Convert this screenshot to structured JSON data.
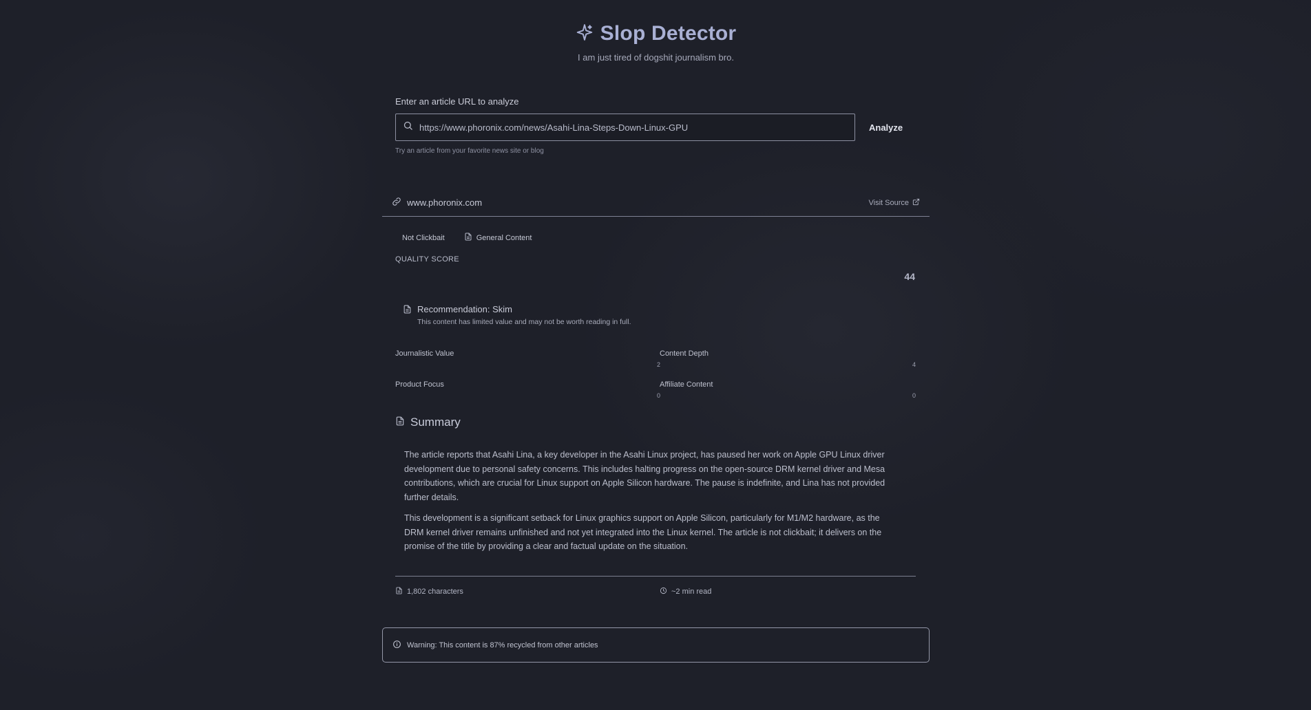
{
  "app": {
    "title": "Slop Detector",
    "subtitle": "I am just tired of dogshit journalism bro."
  },
  "url_form": {
    "label": "Enter an article URL to analyze",
    "value": "https://www.phoronix.com/news/Asahi-Lina-Steps-Down-Linux-GPU",
    "analyze_label": "Analyze",
    "hint": "Try an article from your favorite news site or blog"
  },
  "source": {
    "domain": "www.phoronix.com",
    "visit_label": "Visit Source"
  },
  "badges": {
    "clickbait": "Not Clickbait",
    "content_type": "General Content"
  },
  "quality": {
    "label": "QUALITY SCORE",
    "score": "44"
  },
  "recommendation": {
    "title": "Recommendation: Skim",
    "description": "This content has limited value and may not be worth reading in full."
  },
  "metrics": {
    "journalistic_value": {
      "label": "Journalistic Value",
      "value": "2"
    },
    "content_depth": {
      "label": "Content Depth",
      "value": "4"
    },
    "product_focus": {
      "label": "Product Focus",
      "value": "0"
    },
    "affiliate_content": {
      "label": "Affiliate Content",
      "value": "0"
    }
  },
  "summary": {
    "title": "Summary",
    "paragraphs": [
      "The article reports that Asahi Lina, a key developer in the Asahi Linux project, has paused her work on Apple GPU Linux driver development due to personal safety concerns. This includes halting progress on the open-source DRM kernel driver and Mesa contributions, which are crucial for Linux support on Apple Silicon hardware. The pause is indefinite, and Lina has not provided further details.",
      "This development is a significant setback for Linux graphics support on Apple Silicon, particularly for M1/M2 hardware, as the DRM kernel driver remains unfinished and not yet integrated into the Linux kernel. The article is not clickbait; it delivers on the promise of the title by providing a clear and factual update on the situation."
    ]
  },
  "stats": {
    "characters": "1,802 characters",
    "read_time": "~2 min read"
  },
  "warning": {
    "text": "Warning: This content is 87% recycled from other articles"
  }
}
